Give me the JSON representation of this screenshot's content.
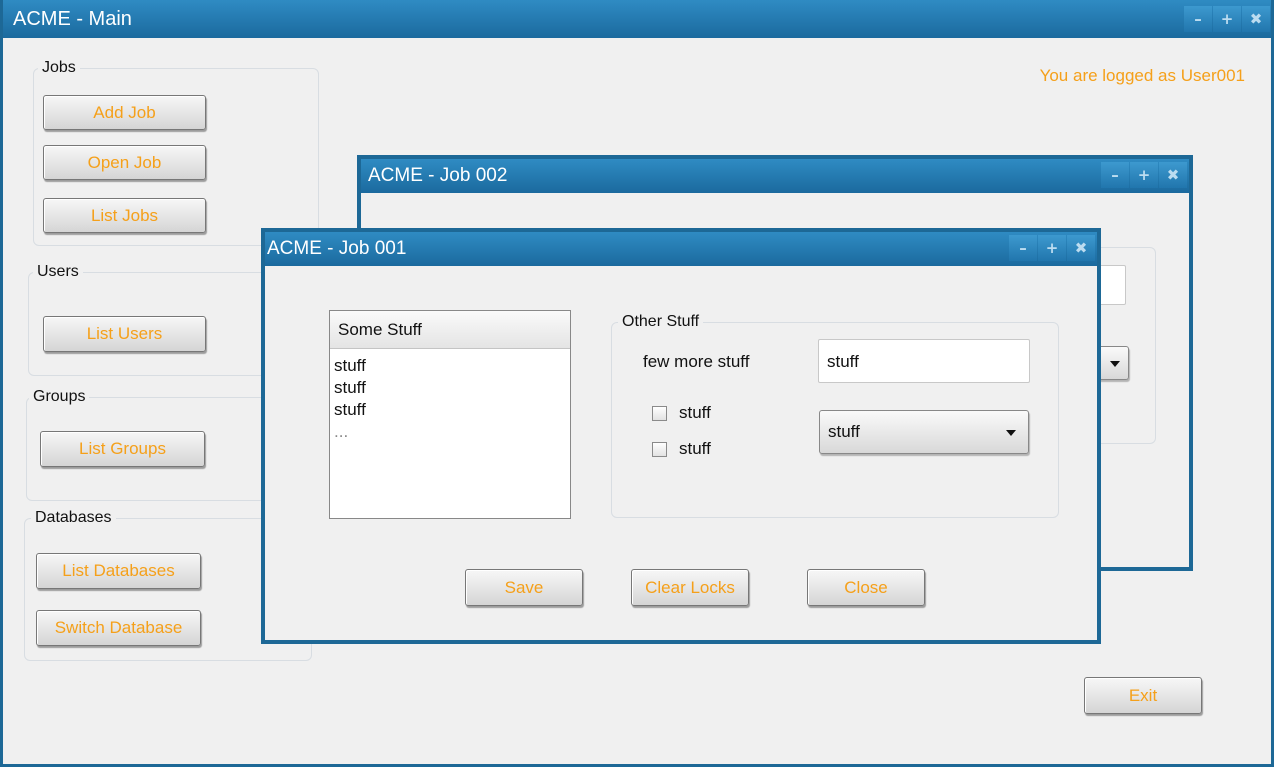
{
  "main_window": {
    "title": "ACME - Main",
    "controls": {
      "minimize": "–",
      "maximize": "+",
      "close": "✖"
    },
    "login_status": "You are logged as User001",
    "exit_label": "Exit",
    "sidebar": {
      "jobs": {
        "title": "Jobs",
        "add_job": "Add Job",
        "open_job": "Open Job",
        "list_jobs": "List Jobs"
      },
      "users": {
        "title": "Users",
        "list_users": "List Users"
      },
      "groups": {
        "title": "Groups",
        "list_groups": "List Groups"
      },
      "databases": {
        "title": "Databases",
        "list_databases": "List Databases",
        "switch_database": "Switch Database"
      }
    }
  },
  "job002_window": {
    "title": "ACME - Job 002",
    "controls": {
      "minimize": "–",
      "maximize": "+",
      "close": "✖"
    }
  },
  "job001_window": {
    "title": "ACME - Job 001",
    "controls": {
      "minimize": "–",
      "maximize": "+",
      "close": "✖"
    },
    "list": {
      "header": "Some Stuff",
      "items": [
        "stuff",
        "stuff",
        "stuff",
        "..."
      ]
    },
    "other_group": {
      "title": "Other Stuff",
      "field_label": "few more stuff",
      "field_value": "stuff",
      "checkbox_1": "stuff",
      "checkbox_2": "stuff",
      "select_value": "stuff"
    },
    "buttons": {
      "save": "Save",
      "clear_locks": "Clear Locks",
      "close": "Close"
    }
  },
  "colors": {
    "titlebar": "#1d6896",
    "accent_text": "#f5a01a",
    "window_bg": "#f0f0f0"
  }
}
